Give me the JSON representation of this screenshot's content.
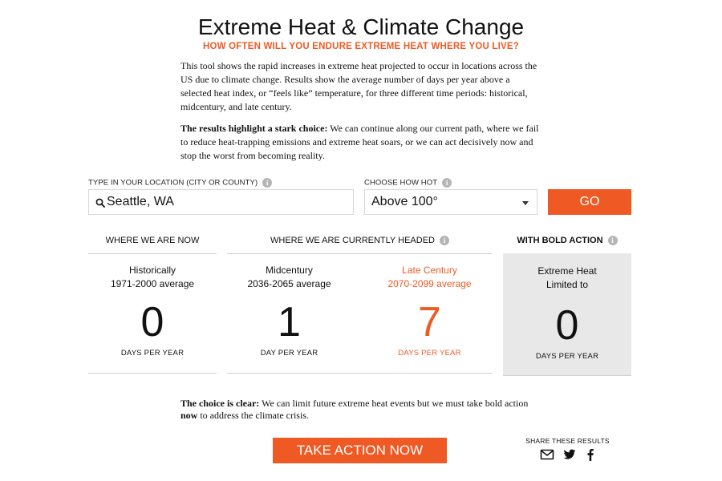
{
  "header": {
    "title": "Extreme Heat & Climate Change",
    "subtitle": "HOW OFTEN WILL YOU ENDURE EXTREME HEAT WHERE YOU LIVE?"
  },
  "intro": {
    "p1": "This tool shows the rapid increases in extreme heat projected to occur in locations across the US due to climate change. Results show the average number of days per year above a selected heat index, or “feels like” temperature, for three different time periods: historical, midcentury, and late century.",
    "p2_bold": "The results highlight a stark choice:",
    "p2_rest": " We can continue along our current path, where we fail to reduce heat-trapping emissions and extreme heat soars, or we can act decisively now and stop the worst from becoming reality."
  },
  "form": {
    "location_label": "TYPE IN YOUR LOCATION (CITY OR COUNTY)",
    "location_value": "Seattle, WA",
    "hotness_label": "CHOOSE HOW HOT",
    "hotness_value": "Above 100°",
    "go_label": "GO",
    "info_glyph": "i"
  },
  "results": {
    "col1_header": "WHERE WE ARE NOW",
    "col2_header": "WHERE WE ARE CURRENTLY HEADED",
    "col3_header": "WITH BOLD ACTION",
    "historical": {
      "line1": "Historically",
      "line2": "1971-2000 average",
      "value": "0",
      "unit": "DAYS PER YEAR"
    },
    "midcentury": {
      "line1": "Midcentury",
      "line2": "2036-2065 average",
      "value": "1",
      "unit": "DAY PER YEAR"
    },
    "late_century": {
      "line1": "Late Century",
      "line2": "2070-2099 average",
      "value": "7",
      "unit": "DAYS PER YEAR"
    },
    "bold_action": {
      "line1": "Extreme Heat",
      "line2": "Limited to",
      "value": "0",
      "unit": "DAYS PER YEAR"
    }
  },
  "closing": {
    "bold": "The choice is clear:",
    "text1": " We can limit future extreme heat events but we must take bold action ",
    "bold2": "now",
    "text2": " to address the climate crisis."
  },
  "cta": {
    "label": "TAKE ACTION NOW"
  },
  "share": {
    "label": "SHARE THESE RESULTS",
    "icons": [
      "email-icon",
      "twitter-icon",
      "facebook-icon"
    ]
  },
  "colors": {
    "accent": "#ef5a24",
    "gray_panel": "#e8e8e8",
    "info_icon": "#b5b5b5"
  }
}
